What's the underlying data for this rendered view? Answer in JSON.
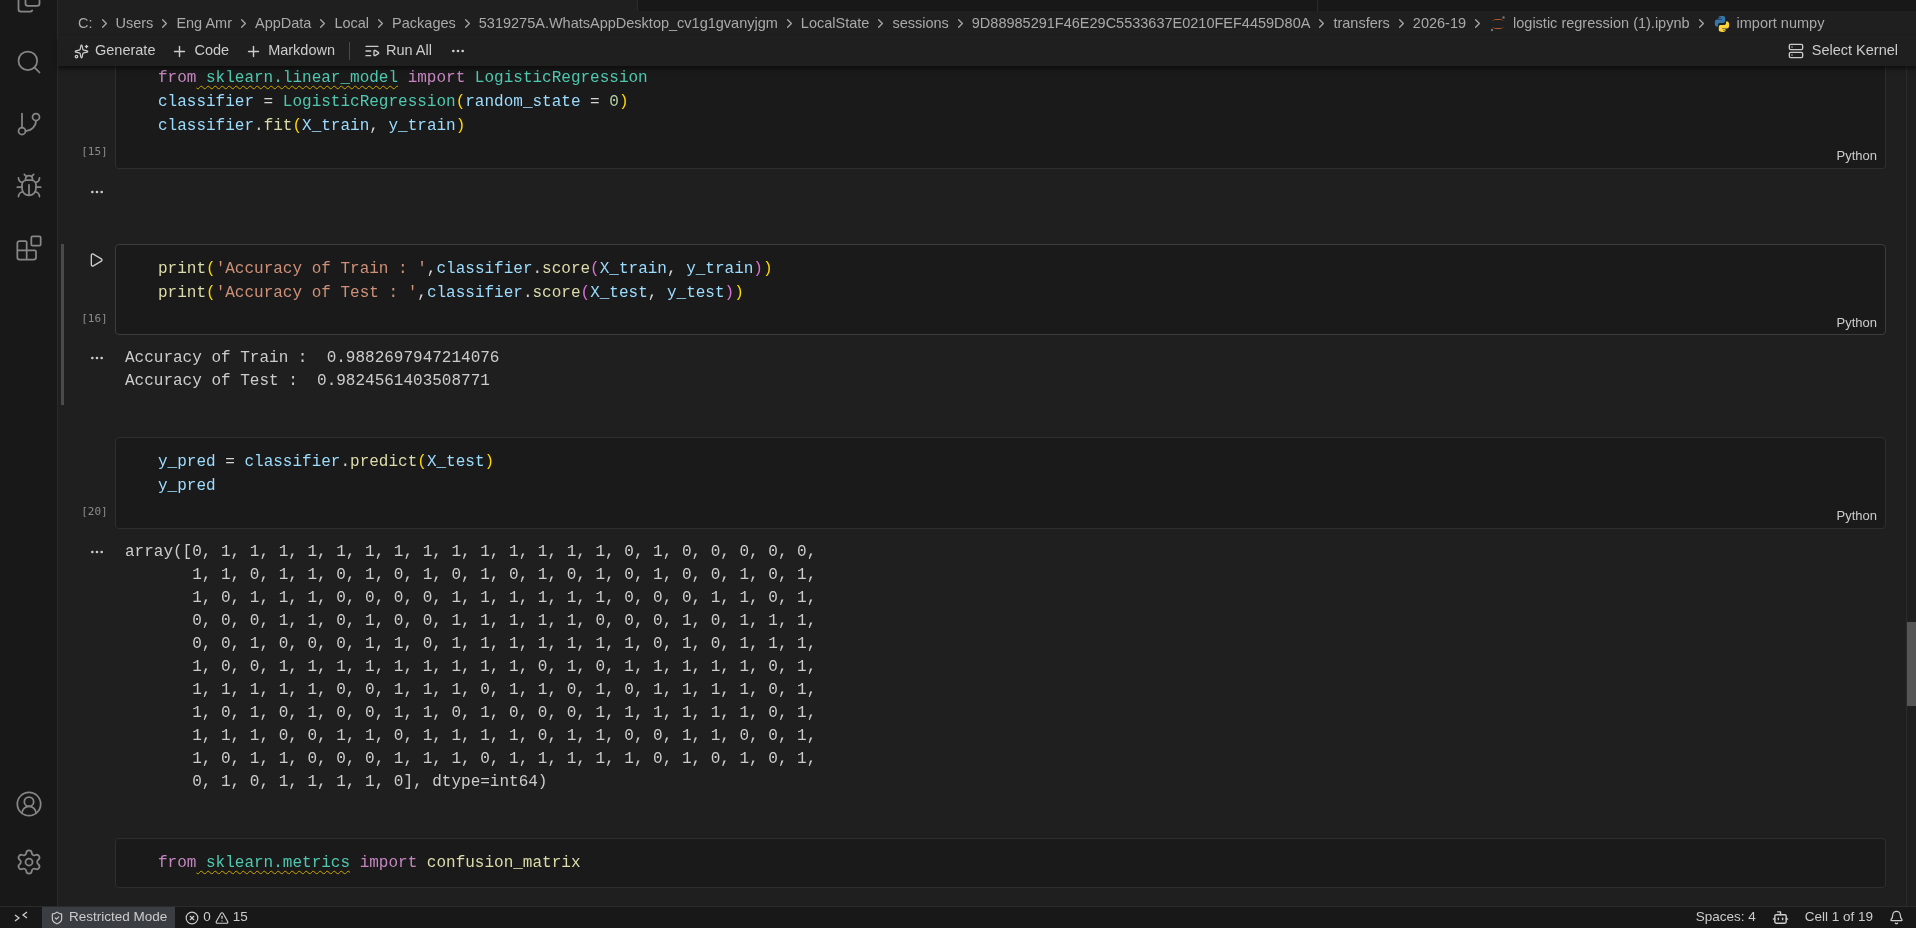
{
  "breadcrumb": [
    {
      "kind": "folder",
      "label": "C:"
    },
    {
      "kind": "folder",
      "label": "Users"
    },
    {
      "kind": "folder",
      "label": "Eng Amr"
    },
    {
      "kind": "folder",
      "label": "AppData"
    },
    {
      "kind": "folder",
      "label": "Local"
    },
    {
      "kind": "folder",
      "label": "Packages"
    },
    {
      "kind": "folder",
      "label": "5319275A.WhatsAppDesktop_cv1g1gvanyjgm"
    },
    {
      "kind": "folder",
      "label": "LocalState"
    },
    {
      "kind": "folder",
      "label": "sessions"
    },
    {
      "kind": "folder",
      "label": "9D88985291F46E29C5533637E0210FEF4459D80A"
    },
    {
      "kind": "folder",
      "label": "transfers"
    },
    {
      "kind": "folder",
      "label": "2026-19"
    },
    {
      "kind": "notebook",
      "label": "logistic regression (1).ipynb"
    },
    {
      "kind": "python",
      "label": "import numpy"
    }
  ],
  "toolbar": {
    "items": [
      {
        "kind": "generate",
        "label": "Generate"
      },
      {
        "kind": "add",
        "label": "Code"
      },
      {
        "kind": "add",
        "label": "Markdown"
      },
      {
        "kind": "run",
        "label": "Run All"
      },
      {
        "kind": "more"
      }
    ],
    "kernel": "Select Kernel"
  },
  "cells": [
    {
      "exec": "[15]",
      "language": "Python",
      "selected": false,
      "output_marker": true,
      "lines": [
        [
          {
            "text": "from",
            "kind": "keyword"
          },
          {
            "text": " sklearn.linear_model",
            "kind": "module",
            "squiggle": true
          },
          {
            "text": " import",
            "kind": "keyword"
          },
          {
            "text": " LogisticRegression",
            "kind": "class"
          }
        ],
        [
          {
            "text": "classifier",
            "kind": "variable"
          },
          {
            "text": " = ",
            "kind": "plain"
          },
          {
            "text": "LogisticRegression",
            "kind": "class"
          },
          {
            "text": "(",
            "kind": "bracket1"
          },
          {
            "text": "random_state",
            "kind": "variable"
          },
          {
            "text": " = ",
            "kind": "plain"
          },
          {
            "text": "0",
            "kind": "number"
          },
          {
            "text": ")",
            "kind": "bracket1"
          }
        ],
        [
          {
            "text": "classifier",
            "kind": "variable"
          },
          {
            "text": ".",
            "kind": "plain"
          },
          {
            "text": "fit",
            "kind": "function"
          },
          {
            "text": "(",
            "kind": "bracket1"
          },
          {
            "text": "X_train",
            "kind": "variable"
          },
          {
            "text": ", ",
            "kind": "plain"
          },
          {
            "text": "y_train",
            "kind": "variable"
          },
          {
            "text": ")",
            "kind": "bracket1"
          }
        ]
      ]
    },
    {
      "exec": "[16]",
      "language": "Python",
      "selected": true,
      "output_marker": true,
      "lines": [
        [
          {
            "text": "print",
            "kind": "function"
          },
          {
            "text": "(",
            "kind": "bracket1"
          },
          {
            "text": "'Accuracy of Train : '",
            "kind": "string"
          },
          {
            "text": ",",
            "kind": "plain"
          },
          {
            "text": "classifier",
            "kind": "variable"
          },
          {
            "text": ".",
            "kind": "plain"
          },
          {
            "text": "score",
            "kind": "function"
          },
          {
            "text": "(",
            "kind": "bracket2"
          },
          {
            "text": "X_train",
            "kind": "variable"
          },
          {
            "text": ", ",
            "kind": "plain"
          },
          {
            "text": "y_train",
            "kind": "variable"
          },
          {
            "text": ")",
            "kind": "bracket2"
          },
          {
            "text": ")",
            "kind": "bracket1"
          }
        ],
        [
          {
            "text": "print",
            "kind": "function"
          },
          {
            "text": "(",
            "kind": "bracket1"
          },
          {
            "text": "'Accuracy of Test : '",
            "kind": "string"
          },
          {
            "text": ",",
            "kind": "plain"
          },
          {
            "text": "classifier",
            "kind": "variable"
          },
          {
            "text": ".",
            "kind": "plain"
          },
          {
            "text": "score",
            "kind": "function"
          },
          {
            "text": "(",
            "kind": "bracket2"
          },
          {
            "text": "X_test",
            "kind": "variable"
          },
          {
            "text": ", ",
            "kind": "plain"
          },
          {
            "text": "y_test",
            "kind": "variable"
          },
          {
            "text": ")",
            "kind": "bracket2"
          },
          {
            "text": ")",
            "kind": "bracket1"
          }
        ]
      ],
      "output_lines": [
        "Accuracy of Train :  0.9882697947214076",
        "Accuracy of Test :  0.9824561403508771"
      ]
    },
    {
      "exec": "[20]",
      "language": "Python",
      "selected": false,
      "output_marker": true,
      "lines": [
        [
          {
            "text": "y_pred",
            "kind": "variable"
          },
          {
            "text": " = ",
            "kind": "plain"
          },
          {
            "text": "classifier",
            "kind": "variable"
          },
          {
            "text": ".",
            "kind": "plain"
          },
          {
            "text": "predict",
            "kind": "function"
          },
          {
            "text": "(",
            "kind": "bracket1"
          },
          {
            "text": "X_test",
            "kind": "variable"
          },
          {
            "text": ")",
            "kind": "bracket1"
          }
        ],
        [
          {
            "text": "y_pred",
            "kind": "variable"
          }
        ]
      ],
      "output_lines": [
        "array([0, 1, 1, 1, 1, 1, 1, 1, 1, 1, 1, 1, 1, 1, 1, 0, 1, 0, 0, 0, 0, 0,",
        "       1, 1, 0, 1, 1, 0, 1, 0, 1, 0, 1, 0, 1, 0, 1, 0, 1, 0, 0, 1, 0, 1,",
        "       1, 0, 1, 1, 1, 0, 0, 0, 0, 1, 1, 1, 1, 1, 1, 0, 0, 0, 1, 1, 0, 1,",
        "       0, 0, 0, 1, 1, 0, 1, 0, 0, 1, 1, 1, 1, 1, 0, 0, 0, 1, 0, 1, 1, 1,",
        "       0, 0, 1, 0, 0, 0, 1, 1, 0, 1, 1, 1, 1, 1, 1, 1, 0, 1, 0, 1, 1, 1,",
        "       1, 0, 0, 1, 1, 1, 1, 1, 1, 1, 1, 1, 0, 1, 0, 1, 1, 1, 1, 1, 0, 1,",
        "       1, 1, 1, 1, 1, 0, 0, 1, 1, 1, 0, 1, 1, 0, 1, 0, 1, 1, 1, 1, 0, 1,",
        "       1, 0, 1, 0, 1, 0, 0, 1, 1, 0, 1, 0, 0, 0, 1, 1, 1, 1, 1, 1, 0, 1,",
        "       1, 1, 1, 0, 0, 1, 1, 0, 1, 1, 1, 1, 0, 1, 1, 0, 0, 1, 1, 0, 0, 1,",
        "       1, 0, 1, 1, 0, 0, 0, 1, 1, 1, 0, 1, 1, 1, 1, 1, 0, 1, 0, 1, 0, 1,",
        "       0, 1, 0, 1, 1, 1, 1, 0], dtype=int64)"
      ]
    },
    {
      "selected": false,
      "output_marker": false,
      "lines": [
        [
          {
            "text": "from",
            "kind": "keyword"
          },
          {
            "text": " sklearn.metrics",
            "kind": "module",
            "squiggle": true
          },
          {
            "text": " import",
            "kind": "keyword"
          },
          {
            "text": " confusion_matrix",
            "kind": "function"
          }
        ]
      ]
    }
  ],
  "status_bar": {
    "restricted_mode": "Restricted Mode",
    "errors": "0",
    "warnings": "15",
    "spaces": "Spaces: 4",
    "cell": "Cell 1 of 19"
  }
}
